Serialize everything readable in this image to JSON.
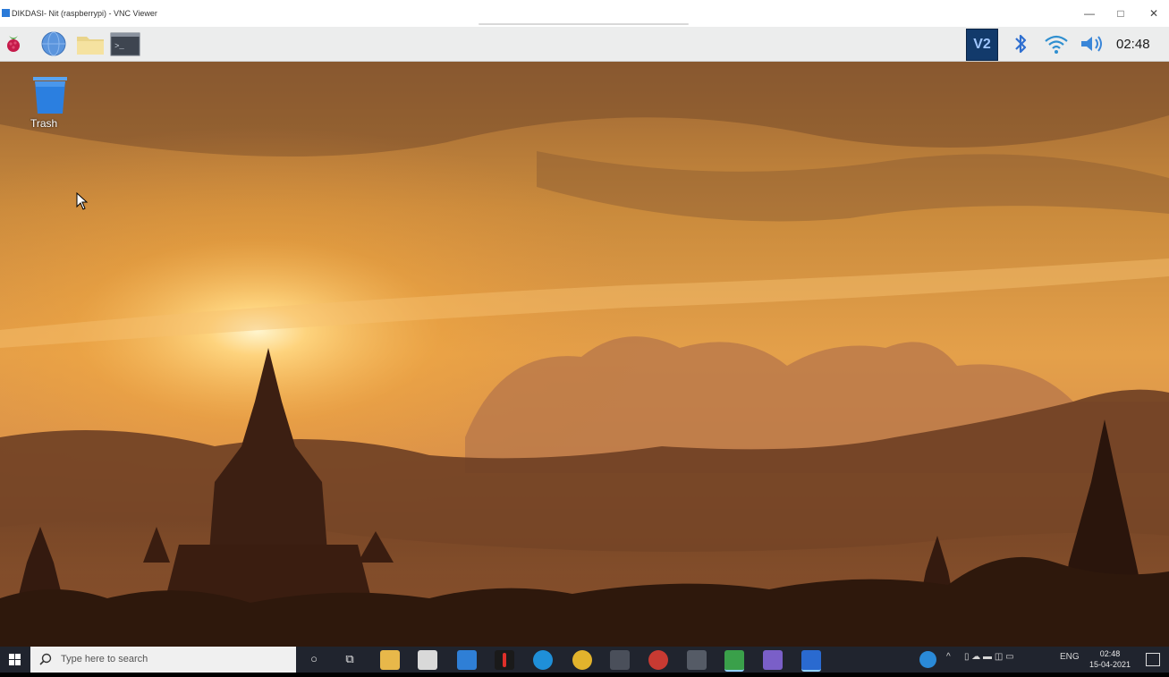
{
  "window": {
    "title": "DIKDASI- Nit (raspberrypi) - VNC Viewer",
    "minimize": "—",
    "maximize": "□",
    "close": "✕"
  },
  "rpi_panel": {
    "launchers": [
      "raspberry-menu-icon",
      "web-browser-icon",
      "file-manager-icon",
      "terminal-icon"
    ],
    "tray": {
      "vnc_label": "V2",
      "clock": "02:48"
    }
  },
  "desktop": {
    "trash_label": "Trash"
  },
  "taskbar": {
    "search_placeholder": "Type here to search",
    "clock_time": "02:48",
    "clock_date": "15-04-2021",
    "language": "ENG"
  },
  "colors": {
    "taskbar": "#20242e",
    "panel": "#eceded",
    "vnc_blue": "#123a6b"
  }
}
